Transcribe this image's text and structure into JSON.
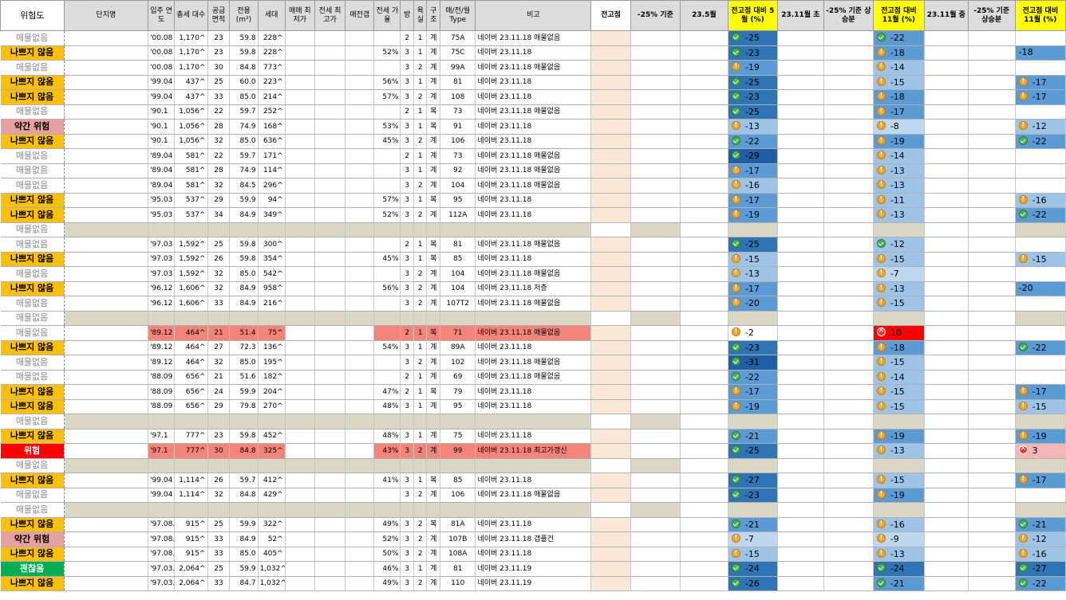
{
  "headers": [
    "위험도",
    "단지명",
    "입주 연도",
    "총세 대수",
    "공급 면적",
    "전용 (m²)",
    "세대",
    "매매 최저가",
    "전세 최고가",
    "매전갭",
    "전세 가율",
    "방",
    "욕실",
    "구조",
    "매/전/월 Type",
    "비고",
    "전고점",
    "-25% 기준",
    "23.5월",
    "전고점 대비 5월 (%)",
    "23.11월 초",
    "-25% 기준 상승분",
    "전고점 대비 11월 (%)",
    "23.11월 중",
    "-25% 기준 상승분",
    "전고점 대비 11월 (%)"
  ],
  "colors": {
    "ok": "#ffc000",
    "mild": "#e6a0a0",
    "danger": "#ff0000",
    "good": "#00b050",
    "separator": "#dbd7c5",
    "highlight": "#f4847a",
    "header_yellow": "#ffff00"
  },
  "icons": {
    "g": "check-circle-icon",
    "o": "warning-circle-icon",
    "x": "cross-circle-icon"
  },
  "rows": [
    {
      "risk": "매물없음",
      "rc": "none",
      "year": "'00.08",
      "total": "1,170^",
      "area": "23",
      "excl": "59.8",
      "units": "228^",
      "ratio": "",
      "rooms": "2",
      "bath": "1",
      "struct": "계",
      "type": "75A",
      "note": "네이버 23.11.18 매물없음",
      "may": {
        "v": "-25",
        "i": "g",
        "b": "b4"
      },
      "nov1": {
        "v": "-22",
        "i": "g",
        "b": "b3"
      },
      "nov2": null
    },
    {
      "risk": "나쁘지 않음",
      "rc": "ok",
      "year": "'00.08",
      "total": "1,170^",
      "area": "23",
      "excl": "59.8",
      "units": "228^",
      "ratio": "52%",
      "rooms": "3",
      "bath": "1",
      "struct": "계",
      "type": "75C",
      "note": "네이버 23.11.18",
      "may": {
        "v": "-23",
        "i": "g",
        "b": "b4"
      },
      "nov1": {
        "v": "-18",
        "i": "o",
        "b": "b3"
      },
      "nov2": {
        "v": "-18",
        "i": "",
        "b": "b3"
      }
    },
    {
      "risk": "매물없음",
      "rc": "none",
      "year": "'00.08",
      "total": "1,170^",
      "area": "30",
      "excl": "84.8",
      "units": "773^",
      "ratio": "",
      "rooms": "3",
      "bath": "2",
      "struct": "계",
      "type": "99A",
      "note": "네이버 23.11.18 매물없음",
      "may": {
        "v": "-19",
        "i": "o",
        "b": "b3"
      },
      "nov1": {
        "v": "-14",
        "i": "o",
        "b": "b2"
      },
      "nov2": null
    },
    {
      "risk": "나쁘지 않음",
      "rc": "ok",
      "year": "'99.04",
      "total": "437^",
      "area": "25",
      "excl": "60.0",
      "units": "223^",
      "ratio": "56%",
      "rooms": "3",
      "bath": "1",
      "struct": "계",
      "type": "81",
      "note": "네이버 23.11.18",
      "may": {
        "v": "-25",
        "i": "g",
        "b": "b4"
      },
      "nov1": {
        "v": "-15",
        "i": "o",
        "b": "b2"
      },
      "nov2": {
        "v": "-17",
        "i": "o",
        "b": "b3"
      }
    },
    {
      "risk": "나쁘지 않음",
      "rc": "ok",
      "year": "'99.04",
      "total": "437^",
      "area": "33",
      "excl": "85.0",
      "units": "214^",
      "ratio": "57%",
      "rooms": "3",
      "bath": "2",
      "struct": "계",
      "type": "108",
      "note": "네이버 23.11.18",
      "may": {
        "v": "-23",
        "i": "g",
        "b": "b4"
      },
      "nov1": {
        "v": "-18",
        "i": "o",
        "b": "b3"
      },
      "nov2": {
        "v": "-17",
        "i": "o",
        "b": "b3"
      }
    },
    {
      "risk": "매물없음",
      "rc": "none",
      "year": "'90.1",
      "total": "1,056^",
      "area": "22",
      "excl": "59.7",
      "units": "252^",
      "ratio": "",
      "rooms": "2",
      "bath": "1",
      "struct": "복",
      "type": "73",
      "note": "네이버 23.11.18 매물없음",
      "may": {
        "v": "-25",
        "i": "g",
        "b": "b4"
      },
      "nov1": {
        "v": "-17",
        "i": "o",
        "b": "b3"
      },
      "nov2": null
    },
    {
      "risk": "약간 위험",
      "rc": "mild",
      "year": "'90.1",
      "total": "1,056^",
      "area": "28",
      "excl": "74.9",
      "units": "168^",
      "ratio": "53%",
      "rooms": "3",
      "bath": "1",
      "struct": "복",
      "type": "91",
      "note": "네이버 23.11.18",
      "may": {
        "v": "-13",
        "i": "o",
        "b": "b2"
      },
      "nov1": {
        "v": "-8",
        "i": "o",
        "b": "b1"
      },
      "nov2": {
        "v": "-12",
        "i": "o",
        "b": "b2"
      }
    },
    {
      "risk": "나쁘지 않음",
      "rc": "ok",
      "year": "'90.1",
      "total": "1,056^",
      "area": "32",
      "excl": "85.0",
      "units": "636^",
      "ratio": "45%",
      "rooms": "3",
      "bath": "2",
      "struct": "계",
      "type": "106",
      "note": "네이버 23.11.18",
      "may": {
        "v": "-22",
        "i": "g",
        "b": "b3"
      },
      "nov1": {
        "v": "-19",
        "i": "o",
        "b": "b3"
      },
      "nov2": {
        "v": "-22",
        "i": "g",
        "b": "b3"
      }
    },
    {
      "risk": "매물없음",
      "rc": "none",
      "year": "'89.04",
      "total": "581^",
      "area": "22",
      "excl": "59.7",
      "units": "171^",
      "ratio": "",
      "rooms": "2",
      "bath": "1",
      "struct": "계",
      "type": "73",
      "note": "네이버 23.11.18 매물없음",
      "may": {
        "v": "-29",
        "i": "g",
        "b": "b5"
      },
      "nov1": {
        "v": "-14",
        "i": "o",
        "b": "b2"
      },
      "nov2": null
    },
    {
      "risk": "매물없음",
      "rc": "none",
      "year": "'89.04",
      "total": "581^",
      "area": "28",
      "excl": "74.9",
      "units": "114^",
      "ratio": "",
      "rooms": "3",
      "bath": "1",
      "struct": "계",
      "type": "92",
      "note": "네이버 23.11.18 매물없음",
      "may": {
        "v": "-17",
        "i": "o",
        "b": "b3"
      },
      "nov1": {
        "v": "-13",
        "i": "o",
        "b": "b2"
      },
      "nov2": null
    },
    {
      "risk": "매물없음",
      "rc": "none",
      "year": "'89.04",
      "total": "581^",
      "area": "32",
      "excl": "84.5",
      "units": "296^",
      "ratio": "",
      "rooms": "3",
      "bath": "2",
      "struct": "계",
      "type": "104",
      "note": "네이버 23.11.18 매물없음",
      "may": {
        "v": "-16",
        "i": "o",
        "b": "b2"
      },
      "nov1": {
        "v": "-13",
        "i": "o",
        "b": "b2"
      },
      "nov2": null
    },
    {
      "risk": "나쁘지 않음",
      "rc": "ok",
      "year": "'95.03",
      "total": "537^",
      "area": "29",
      "excl": "59.9",
      "units": "94^",
      "ratio": "57%",
      "rooms": "3",
      "bath": "1",
      "struct": "복",
      "type": "95",
      "note": "네이버 23.11.18",
      "may": {
        "v": "-17",
        "i": "o",
        "b": "b3"
      },
      "nov1": {
        "v": "-11",
        "i": "o",
        "b": "b2"
      },
      "nov2": {
        "v": "-16",
        "i": "o",
        "b": "b2"
      }
    },
    {
      "risk": "나쁘지 않음",
      "rc": "ok",
      "year": "'95.03",
      "total": "537^",
      "area": "34",
      "excl": "84.9",
      "units": "349^",
      "ratio": "52%",
      "rooms": "3",
      "bath": "2",
      "struct": "계",
      "type": "112A",
      "note": "네이버 23.11.18",
      "may": {
        "v": "-19",
        "i": "o",
        "b": "b3"
      },
      "nov1": {
        "v": "-13",
        "i": "o",
        "b": "b2"
      },
      "nov2": {
        "v": "-22",
        "i": "g",
        "b": "b3"
      }
    },
    {
      "sep": true,
      "risk": "매물없음",
      "rc": "none"
    },
    {
      "risk": "매물없음",
      "rc": "none",
      "year": "'97.03",
      "total": "1,592^",
      "area": "25",
      "excl": "59.8",
      "units": "300^",
      "ratio": "",
      "rooms": "2",
      "bath": "1",
      "struct": "복",
      "type": "81",
      "note": "네이버 23.11.18 매물없음",
      "may": {
        "v": "-25",
        "i": "g",
        "b": "b4"
      },
      "nov1": {
        "v": "-12",
        "i": "g",
        "b": "b2"
      },
      "nov2": null
    },
    {
      "risk": "나쁘지 않음",
      "rc": "ok",
      "year": "'97.03",
      "total": "1,592^",
      "area": "26",
      "excl": "59.8",
      "units": "354^",
      "ratio": "45%",
      "rooms": "3",
      "bath": "1",
      "struct": "복",
      "type": "85",
      "note": "네이버 23.11.18",
      "may": {
        "v": "-15",
        "i": "o",
        "b": "b2"
      },
      "nov1": {
        "v": "-15",
        "i": "o",
        "b": "b2"
      },
      "nov2": {
        "v": "-15",
        "i": "o",
        "b": "b2"
      }
    },
    {
      "risk": "매물없음",
      "rc": "none",
      "year": "'97.03",
      "total": "1,592^",
      "area": "32",
      "excl": "85.0",
      "units": "542^",
      "ratio": "",
      "rooms": "3",
      "bath": "2",
      "struct": "계",
      "type": "104",
      "note": "네이버 23.11.18 매물없음",
      "may": {
        "v": "-13",
        "i": "o",
        "b": "b2"
      },
      "nov1": {
        "v": "-7",
        "i": "o",
        "b": "b1"
      },
      "nov2": null
    },
    {
      "risk": "나쁘지 않음",
      "rc": "ok",
      "year": "'96.12",
      "total": "1,606^",
      "area": "32",
      "excl": "84.9",
      "units": "958^",
      "ratio": "56%",
      "rooms": "3",
      "bath": "2",
      "struct": "계",
      "type": "104",
      "note": "네이버 23.11.18 저층",
      "may": {
        "v": "-17",
        "i": "o",
        "b": "b3"
      },
      "nov1": {
        "v": "-13",
        "i": "o",
        "b": "b2"
      },
      "nov2": {
        "v": "-20",
        "i": "",
        "b": "b3"
      }
    },
    {
      "risk": "매물없음",
      "rc": "none",
      "year": "'96.12",
      "total": "1,606^",
      "area": "33",
      "excl": "84.9",
      "units": "216^",
      "ratio": "",
      "rooms": "3",
      "bath": "2",
      "struct": "계",
      "type": "107T2",
      "note": "네이버 23.11.18 매물없음",
      "may": {
        "v": "-20",
        "i": "o",
        "b": "b3"
      },
      "nov1": {
        "v": "-15",
        "i": "o",
        "b": "b2"
      },
      "nov2": null
    },
    {
      "sep": true,
      "risk": "매물없음",
      "rc": "none"
    },
    {
      "risk": "매물없음",
      "rc": "none",
      "hl": true,
      "year": "'89.12",
      "total": "464^",
      "area": "21",
      "excl": "51.4",
      "units": "75^",
      "ratio": "",
      "rooms": "2",
      "bath": "1",
      "struct": "복",
      "type": "71",
      "note": "네이버 23.11.18 매물없음",
      "may": {
        "v": "-2",
        "i": "o",
        "b": "b0"
      },
      "nov1": {
        "v": "10",
        "i": "x",
        "b": "bred"
      },
      "nov2": null
    },
    {
      "risk": "나쁘지 않음",
      "rc": "ok",
      "year": "'89.12",
      "total": "464^",
      "area": "27",
      "excl": "72.3",
      "units": "136^",
      "ratio": "54%",
      "rooms": "3",
      "bath": "1",
      "struct": "계",
      "type": "89A",
      "note": "네이버 23.11.18",
      "may": {
        "v": "-23",
        "i": "g",
        "b": "b4"
      },
      "nov1": {
        "v": "-18",
        "i": "o",
        "b": "b3"
      },
      "nov2": {
        "v": "-22",
        "i": "g",
        "b": "b3"
      }
    },
    {
      "risk": "매물없음",
      "rc": "none",
      "year": "'89.12",
      "total": "464^",
      "area": "32",
      "excl": "85.0",
      "units": "195^",
      "ratio": "",
      "rooms": "3",
      "bath": "2",
      "struct": "계",
      "type": "102",
      "note": "네이버 23.11.18 매물없음",
      "may": {
        "v": "-31",
        "i": "g",
        "b": "b5"
      },
      "nov1": {
        "v": "-15",
        "i": "o",
        "b": "b2"
      },
      "nov2": null
    },
    {
      "risk": "매물없음",
      "rc": "none",
      "year": "'88.09",
      "total": "656^",
      "area": "21",
      "excl": "51.6",
      "units": "182^",
      "ratio": "",
      "rooms": "2",
      "bath": "1",
      "struct": "계",
      "type": "69",
      "note": "네이버 23.11.18 매물없음",
      "may": {
        "v": "-22",
        "i": "g",
        "b": "b3"
      },
      "nov1": {
        "v": "-14",
        "i": "o",
        "b": "b2"
      },
      "nov2": null
    },
    {
      "risk": "나쁘지 않음",
      "rc": "ok",
      "year": "'88.09",
      "total": "656^",
      "area": "24",
      "excl": "59.9",
      "units": "204^",
      "ratio": "47%",
      "rooms": "2",
      "bath": "1",
      "struct": "복",
      "type": "79",
      "note": "네이버 23.11.18",
      "may": {
        "v": "-17",
        "i": "o",
        "b": "b3"
      },
      "nov1": {
        "v": "-15",
        "i": "o",
        "b": "b2"
      },
      "nov2": {
        "v": "-17",
        "i": "o",
        "b": "b3"
      }
    },
    {
      "risk": "나쁘지 않음",
      "rc": "ok",
      "year": "'88.09",
      "total": "656^",
      "area": "29",
      "excl": "79.8",
      "units": "270^",
      "ratio": "48%",
      "rooms": "3",
      "bath": "1",
      "struct": "계",
      "type": "95",
      "note": "네이버 23.11.18",
      "may": {
        "v": "-19",
        "i": "o",
        "b": "b3"
      },
      "nov1": {
        "v": "-15",
        "i": "o",
        "b": "b2"
      },
      "nov2": {
        "v": "-15",
        "i": "o",
        "b": "b2"
      }
    },
    {
      "sep": true,
      "risk": "매물없음",
      "rc": "none"
    },
    {
      "risk": "나쁘지 않음",
      "rc": "ok",
      "year": "'97.1",
      "total": "777^",
      "area": "23",
      "excl": "59.8",
      "units": "452^",
      "ratio": "48%",
      "rooms": "3",
      "bath": "1",
      "struct": "계",
      "type": "75",
      "note": "네이버 23.11.18",
      "may": {
        "v": "-21",
        "i": "g",
        "b": "b3"
      },
      "nov1": {
        "v": "-19",
        "i": "o",
        "b": "b3"
      },
      "nov2": {
        "v": "-19",
        "i": "o",
        "b": "b3"
      }
    },
    {
      "risk": "위험",
      "rc": "danger",
      "hl": true,
      "year": "'97.1",
      "total": "777^",
      "area": "30",
      "excl": "84.8",
      "units": "325^",
      "ratio": "43%",
      "rooms": "3",
      "bath": "2",
      "struct": "계",
      "type": "99",
      "note": "네이버 23.11.18 최고가갱신",
      "may": {
        "v": "-25",
        "i": "g",
        "b": "b4"
      },
      "nov1": {
        "v": "-13",
        "i": "o",
        "b": "b2"
      },
      "nov2": {
        "v": "3",
        "i": "x",
        "b": "bpink"
      }
    },
    {
      "sep": true,
      "risk": "매물없음",
      "rc": "none"
    },
    {
      "risk": "나쁘지 않음",
      "rc": "ok",
      "year": "'99.04",
      "total": "1,114^",
      "area": "26",
      "excl": "59.7",
      "units": "412^",
      "ratio": "41%",
      "rooms": "3",
      "bath": "1",
      "struct": "복",
      "type": "85",
      "note": "네이버 23.11.18",
      "may": {
        "v": "-27",
        "i": "g",
        "b": "b4"
      },
      "nov1": {
        "v": "-15",
        "i": "o",
        "b": "b2"
      },
      "nov2": {
        "v": "-17",
        "i": "o",
        "b": "b3"
      }
    },
    {
      "risk": "매물없음",
      "rc": "none",
      "year": "'99.04",
      "total": "1,114^",
      "area": "32",
      "excl": "84.8",
      "units": "429^",
      "ratio": "",
      "rooms": "3",
      "bath": "2",
      "struct": "계",
      "type": "106",
      "note": "네이버 23.11.18 매물없음",
      "may": {
        "v": "-23",
        "i": "g",
        "b": "b4"
      },
      "nov1": {
        "v": "-19",
        "i": "o",
        "b": "b3"
      },
      "nov2": null
    },
    {
      "sep": true,
      "risk": "매물없음",
      "rc": "none"
    },
    {
      "risk": "나쁘지 않음",
      "rc": "ok",
      "year": "'97.08.",
      "total": "915^",
      "area": "25",
      "excl": "59.9",
      "units": "322^",
      "ratio": "49%",
      "rooms": "3",
      "bath": "2",
      "struct": "복",
      "type": "81A",
      "note": "네이버 23.11.18",
      "may": {
        "v": "-21",
        "i": "g",
        "b": "b3"
      },
      "nov1": {
        "v": "-16",
        "i": "o",
        "b": "b2"
      },
      "nov2": {
        "v": "-21",
        "i": "g",
        "b": "b3"
      }
    },
    {
      "risk": "약간 위험",
      "rc": "mild",
      "year": "'97.08.",
      "total": "915^",
      "area": "33",
      "excl": "84.9",
      "units": "52^",
      "ratio": "52%",
      "rooms": "3",
      "bath": "2",
      "struct": "계",
      "type": "107B",
      "note": "네이버 23.11.18 갭플건",
      "may": {
        "v": "-7",
        "i": "o",
        "b": "b1"
      },
      "nov1": {
        "v": "-9",
        "i": "o",
        "b": "b1"
      },
      "nov2": {
        "v": "-12",
        "i": "o",
        "b": "b2"
      }
    },
    {
      "risk": "나쁘지 않음",
      "rc": "ok",
      "year": "'97.08.",
      "total": "915^",
      "area": "33",
      "excl": "85.0",
      "units": "405^",
      "ratio": "50%",
      "rooms": "3",
      "bath": "2",
      "struct": "계",
      "type": "108A",
      "note": "네이버 23.11.18",
      "may": {
        "v": "-15",
        "i": "o",
        "b": "b2"
      },
      "nov1": {
        "v": "-13",
        "i": "o",
        "b": "b2"
      },
      "nov2": {
        "v": "-16",
        "i": "o",
        "b": "b2"
      }
    },
    {
      "risk": "괜찮음",
      "rc": "good",
      "year": "'97.03.",
      "total": "2,064^",
      "area": "25",
      "excl": "59.9",
      "units": "1,032^",
      "ratio": "46%",
      "rooms": "3",
      "bath": "1",
      "struct": "계",
      "type": "81",
      "note": "네이버 23.11.19",
      "may": {
        "v": "-24",
        "i": "g",
        "b": "b4"
      },
      "nov1": {
        "v": "-24",
        "i": "g",
        "b": "b4"
      },
      "nov2": {
        "v": "-27",
        "i": "g",
        "b": "b4"
      }
    },
    {
      "risk": "나쁘지 않음",
      "rc": "ok",
      "year": "'97.03.",
      "total": "2,064^",
      "area": "33",
      "excl": "84.7",
      "units": "1,032^",
      "ratio": "49%",
      "rooms": "3",
      "bath": "2",
      "struct": "계",
      "type": "110",
      "note": "네이버 23.11.19",
      "may": {
        "v": "-26",
        "i": "g",
        "b": "b4"
      },
      "nov1": {
        "v": "-21",
        "i": "g",
        "b": "b3"
      },
      "nov2": {
        "v": "-22",
        "i": "g",
        "b": "b3"
      }
    }
  ]
}
